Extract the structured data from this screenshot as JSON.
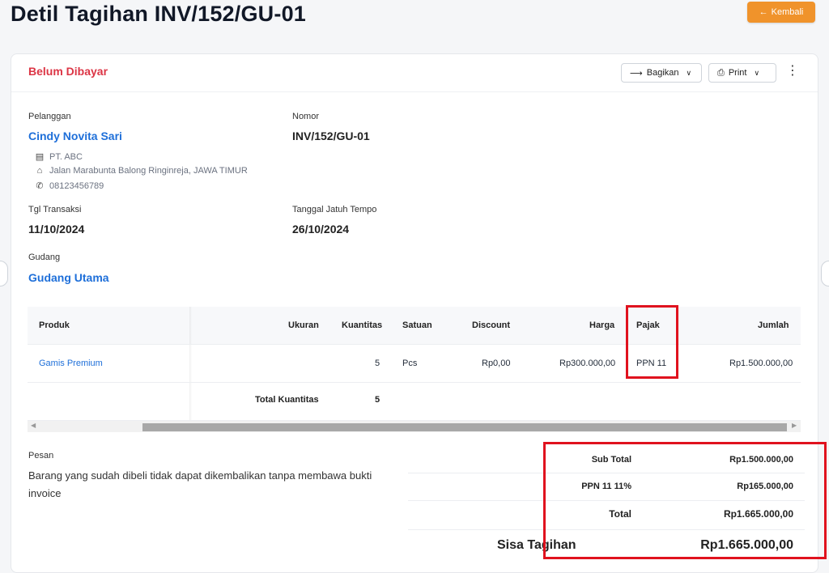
{
  "page": {
    "title": "Detil Tagihan INV/152/GU-01",
    "back_label": "Kembali",
    "back_icon": "arrow-left-icon"
  },
  "header": {
    "status": "Belum Dibayar",
    "status_color": "#dc3545",
    "share_label": "Bagikan",
    "print_label": "Print"
  },
  "info": {
    "customer_label": "Pelanggan",
    "customer_name": "Cindy Novita Sari",
    "company": "PT. ABC",
    "address": "Jalan Marabunta Balong Ringinreja, JAWA TIMUR",
    "phone": "08123456789",
    "number_label": "Nomor",
    "number": "INV/152/GU-01",
    "trx_date_label": "Tgl Transaksi",
    "trx_date": "11/10/2024",
    "due_date_label": "Tanggal Jatuh Tempo",
    "due_date": "26/10/2024",
    "warehouse_label": "Gudang",
    "warehouse": "Gudang Utama"
  },
  "table": {
    "headers": {
      "product": "Produk",
      "size": "Ukuran",
      "qty": "Kuantitas",
      "unit": "Satuan",
      "discount": "Discount",
      "price": "Harga",
      "tax": "Pajak",
      "amount": "Jumlah"
    },
    "rows": [
      {
        "product": "Gamis Premium",
        "size": "",
        "qty": "5",
        "unit": "Pcs",
        "discount": "Rp0,00",
        "price": "Rp300.000,00",
        "tax": "PPN 11",
        "amount": "Rp1.500.000,00"
      }
    ],
    "total_qty_label": "Total Kuantitas",
    "total_qty": "5"
  },
  "message": {
    "label": "Pesan",
    "text": "Barang yang sudah dibeli tidak dapat dikembalikan tanpa membawa bukti invoice"
  },
  "summary": {
    "subtotal_label": "Sub Total",
    "subtotal": "Rp1.500.000,00",
    "tax_label": "PPN 11 11%",
    "tax": "Rp165.000,00",
    "total_label": "Total",
    "total": "Rp1.665.000,00",
    "balance_label": "Sisa Tagihan",
    "balance": "Rp1.665.000,00"
  },
  "colors": {
    "accent": "#f0932b",
    "link": "#1e6fd9",
    "highlight": "#e0121e"
  }
}
